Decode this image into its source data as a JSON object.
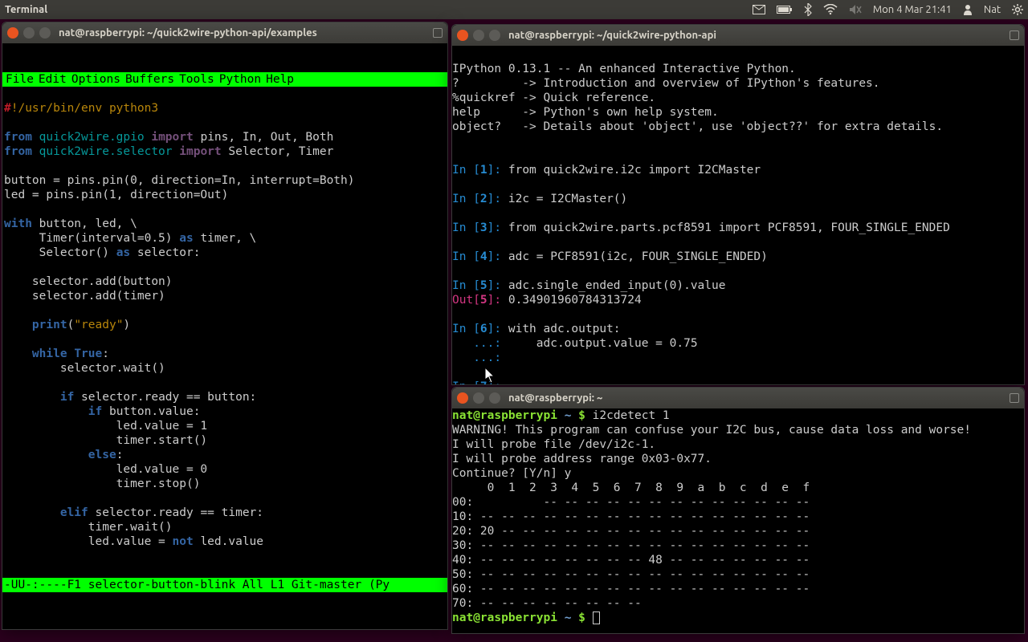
{
  "panel": {
    "app": "Terminal",
    "clock": "Mon 4 Mar 21:41",
    "user": "Nat"
  },
  "win_emacs": {
    "title": "nat@raspberrypi: ~/quick2wire-python-api/examples",
    "menubar": [
      "File",
      "Edit",
      "Options",
      "Buffers",
      "Tools",
      "Python",
      "Help"
    ],
    "modeline": "-UU-:----F1   selector-button-blink   All L1    Git-master  (Py",
    "code": {
      "shebang_hash": "#",
      "shebang_rest": "!/usr/bin/env python3",
      "l_from": "from",
      "l_mod1": "quick2wire.gpio",
      "l_import": "import",
      "l_imp1": "pins, In, Out, Both",
      "l_mod2": "quick2wire.selector",
      "l_imp2": "Selector, Timer",
      "button_lhs": "button = pins.pin(0, direction=In, interrupt=Both)",
      "led_lhs": "led = pins.pin(1, direction=Out)",
      "with": "with",
      "with_rest": " button, led, \\",
      "timer_line_pre": "     Timer(interval=0.5) ",
      "as": "as",
      "timer_line_post": " timer, \\",
      "selector_line_pre": "     Selector() ",
      "selector_line_post": " selector:",
      "add_button": "    selector.add(button)",
      "add_timer": "    selector.add(timer)",
      "print": "print",
      "print_pre": "    ",
      "ready_str": "\"ready\"",
      "print_post": "(",
      "print_post2": ")",
      "while": "while",
      "while_pre": "    ",
      "true": "True",
      "while_post": ":",
      "sel_wait": "        selector.wait()",
      "if": "if",
      "if_pre": "        ",
      "if_rest": " selector.ready == button:",
      "if2_pre": "            ",
      "if2_rest": " button.value:",
      "led1": "                led.value = 1",
      "tstart": "                timer.start()",
      "else": "else",
      "else_pre": "            ",
      "else_post": ":",
      "led0": "                led.value = 0",
      "tstop": "                timer.stop()",
      "elif": "elif",
      "elif_pre": "        ",
      "elif_rest": " selector.ready == timer:",
      "twait": "            timer.wait()",
      "lednot_pre": "            led.value = ",
      "not": "not",
      "lednot_post": " led.value"
    }
  },
  "win_ipy": {
    "title": "nat@raspberrypi: ~/quick2wire-python-api",
    "header": [
      "IPython 0.13.1 -- An enhanced Interactive Python.",
      "?         -> Introduction and overview of IPython's features.",
      "%quickref -> Quick reference.",
      "help      -> Python's own help system.",
      "object?   -> Details about 'object', use 'object??' for extra details."
    ],
    "lines": [
      {
        "in": "1",
        "code": "from quick2wire.i2c import I2CMaster"
      },
      {
        "in": "2",
        "code": "i2c = I2CMaster()"
      },
      {
        "in": "3",
        "code": "from quick2wire.parts.pcf8591 import PCF8591, FOUR_SINGLE_ENDED"
      },
      {
        "in": "4",
        "code": "adc = PCF8591(i2c, FOUR_SINGLE_ENDED)"
      },
      {
        "in": "5",
        "code": "adc.single_ended_input(0).value"
      }
    ],
    "out5": "0.34901960784313724",
    "in6": "with adc.output:",
    "in6b": "    adc.output.value = 0.75",
    "in7": ""
  },
  "win_sh": {
    "title": "nat@raspberrypi: ~",
    "host": "nat@raspberrypi",
    "path": "~",
    "cmd": "i2cdetect 1",
    "lines": [
      "WARNING! This program can confuse your I2C bus, cause data loss and worse!",
      "I will probe file /dev/i2c-1.",
      "I will probe address range 0x03-0x77.",
      "Continue? [Y/n] y",
      "     0  1  2  3  4  5  6  7  8  9  a  b  c  d  e  f",
      "00:          -- -- -- -- -- -- -- -- -- -- -- -- --",
      "10: -- -- -- -- -- -- -- -- -- -- -- -- -- -- -- --",
      "20: 20 -- -- -- -- -- -- -- -- -- -- -- -- -- -- --",
      "30: -- -- -- -- -- -- -- -- -- -- -- -- -- -- -- --",
      "40: -- -- -- -- -- -- -- -- 48 -- -- -- -- -- -- --",
      "50: -- -- -- -- -- -- -- -- -- -- -- -- -- -- -- --",
      "60: -- -- -- -- -- -- -- -- -- -- -- -- -- -- -- --",
      "70: -- -- -- -- -- -- -- --"
    ]
  }
}
